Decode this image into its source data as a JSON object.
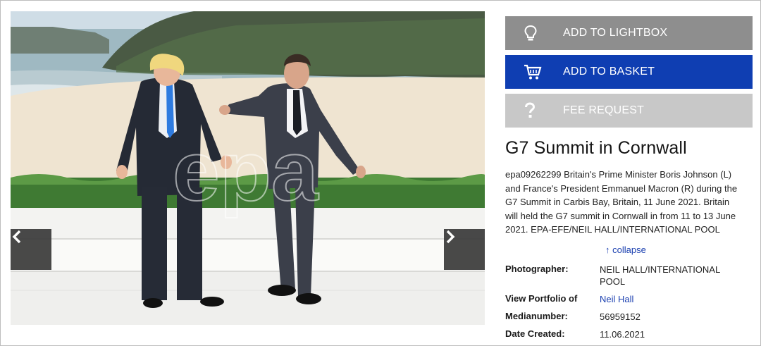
{
  "actions": {
    "lightbox": "ADD TO LIGHTBOX",
    "basket": "ADD TO BASKET",
    "fee": "FEE REQUEST"
  },
  "image": {
    "watermark": "epa",
    "icons": {
      "prev": "chevron-left-icon",
      "next": "chevron-right-icon"
    }
  },
  "title": "G7 Summit in Cornwall",
  "caption": "epa09262299 Britain's Prime Minister Boris Johnson (L) and France's President Emmanuel Macron (R) during the G7 Summit in Carbis Bay, Britain, 11 June 2021. Britain will held the G7 summit in Cornwall in from 11 to 13 June 2021. EPA-EFE/NEIL HALL/INTERNATIONAL POOL",
  "collapse_label": "↑ collapse",
  "meta": {
    "photographer_label": "Photographer:",
    "photographer": "NEIL HALL/INTERNATIONAL POOL",
    "portfolio_label": "View Portfolio of",
    "portfolio": "Neil Hall",
    "medianumber_label": "Medianumber:",
    "medianumber": "56959152",
    "date_label": "Date Created:",
    "date": "11.06.2021"
  },
  "colors": {
    "basket": "#0f3eb2",
    "lightbox": "#8e8e8e",
    "fee": "#c8c8c8",
    "link": "#1a3fb0"
  }
}
